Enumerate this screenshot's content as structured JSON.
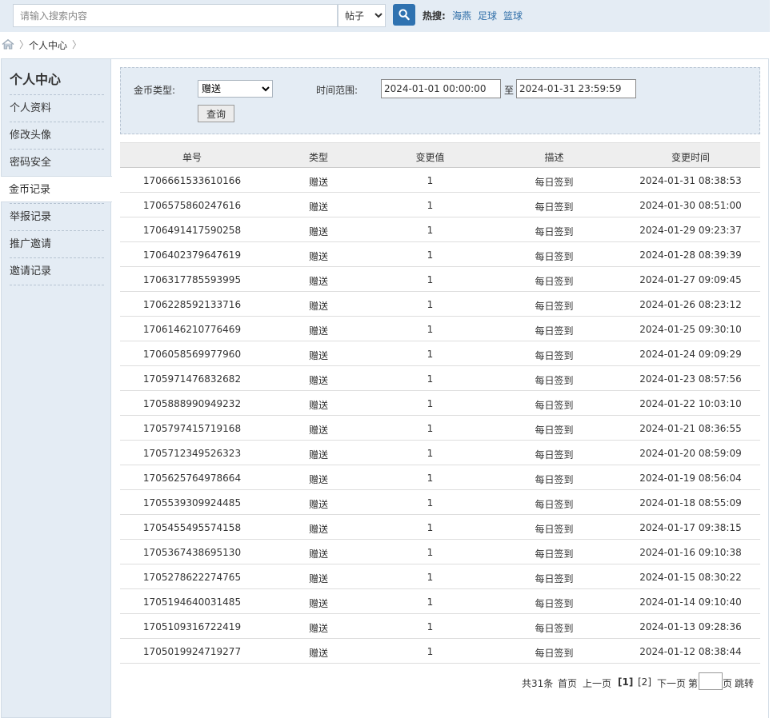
{
  "search": {
    "placeholder": "请输入搜索内容",
    "value": "",
    "type_selected": "帖子",
    "hot_label": "热搜:",
    "hot_links": [
      "海燕",
      "足球",
      "篮球"
    ]
  },
  "breadcrumb": {
    "items": [
      "个人中心"
    ],
    "separator": "〉"
  },
  "sidebar": {
    "title": "个人中心",
    "items": [
      {
        "label": "个人资料",
        "active": false
      },
      {
        "label": "修改头像",
        "active": false
      },
      {
        "label": "密码安全",
        "active": false
      },
      {
        "label": "金币记录",
        "active": true
      },
      {
        "label": "举报记录",
        "active": false
      },
      {
        "label": "推广邀请",
        "active": false
      },
      {
        "label": "邀请记录",
        "active": false
      }
    ]
  },
  "filter": {
    "coin_type_label": "金币类型:",
    "coin_type_selected": "赠送",
    "time_range_label": "时间范围:",
    "start_time": "2024-01-01 00:00:00",
    "to_label": "至",
    "end_time": "2024-01-31 23:59:59",
    "query_button": "查询"
  },
  "table": {
    "headers": [
      "单号",
      "类型",
      "变更值",
      "描述",
      "变更时间"
    ],
    "rows": [
      [
        "1706661533610166",
        "赠送",
        "1",
        "每日签到",
        "2024-01-31 08:38:53"
      ],
      [
        "1706575860247616",
        "赠送",
        "1",
        "每日签到",
        "2024-01-30 08:51:00"
      ],
      [
        "1706491417590258",
        "赠送",
        "1",
        "每日签到",
        "2024-01-29 09:23:37"
      ],
      [
        "1706402379647619",
        "赠送",
        "1",
        "每日签到",
        "2024-01-28 08:39:39"
      ],
      [
        "1706317785593995",
        "赠送",
        "1",
        "每日签到",
        "2024-01-27 09:09:45"
      ],
      [
        "1706228592133716",
        "赠送",
        "1",
        "每日签到",
        "2024-01-26 08:23:12"
      ],
      [
        "1706146210776469",
        "赠送",
        "1",
        "每日签到",
        "2024-01-25 09:30:10"
      ],
      [
        "1706058569977960",
        "赠送",
        "1",
        "每日签到",
        "2024-01-24 09:09:29"
      ],
      [
        "1705971476832682",
        "赠送",
        "1",
        "每日签到",
        "2024-01-23 08:57:56"
      ],
      [
        "1705888990949232",
        "赠送",
        "1",
        "每日签到",
        "2024-01-22 10:03:10"
      ],
      [
        "1705797415719168",
        "赠送",
        "1",
        "每日签到",
        "2024-01-21 08:36:55"
      ],
      [
        "1705712349526323",
        "赠送",
        "1",
        "每日签到",
        "2024-01-20 08:59:09"
      ],
      [
        "1705625764978664",
        "赠送",
        "1",
        "每日签到",
        "2024-01-19 08:56:04"
      ],
      [
        "1705539309924485",
        "赠送",
        "1",
        "每日签到",
        "2024-01-18 08:55:09"
      ],
      [
        "1705455495574158",
        "赠送",
        "1",
        "每日签到",
        "2024-01-17 09:38:15"
      ],
      [
        "1705367438695130",
        "赠送",
        "1",
        "每日签到",
        "2024-01-16 09:10:38"
      ],
      [
        "1705278622274765",
        "赠送",
        "1",
        "每日签到",
        "2024-01-15 08:30:22"
      ],
      [
        "1705194640031485",
        "赠送",
        "1",
        "每日签到",
        "2024-01-14 09:10:40"
      ],
      [
        "1705109316722419",
        "赠送",
        "1",
        "每日签到",
        "2024-01-13 09:28:36"
      ],
      [
        "1705019924719277",
        "赠送",
        "1",
        "每日签到",
        "2024-01-12 08:38:44"
      ]
    ]
  },
  "pagination": {
    "total": "共31条",
    "first": "首页",
    "prev": "上一页",
    "current_page": "[1]",
    "page_2": "[2]",
    "next": "下一页",
    "goto_prefix": "第",
    "goto_value": "",
    "goto_suffix": "页",
    "jump": "跳转"
  },
  "colors": {
    "accent": "#2f72b0",
    "link": "#2f6ea8",
    "panel_bg": "#e4ecf4"
  },
  "icons": [
    "search-icon",
    "home-icon"
  ]
}
